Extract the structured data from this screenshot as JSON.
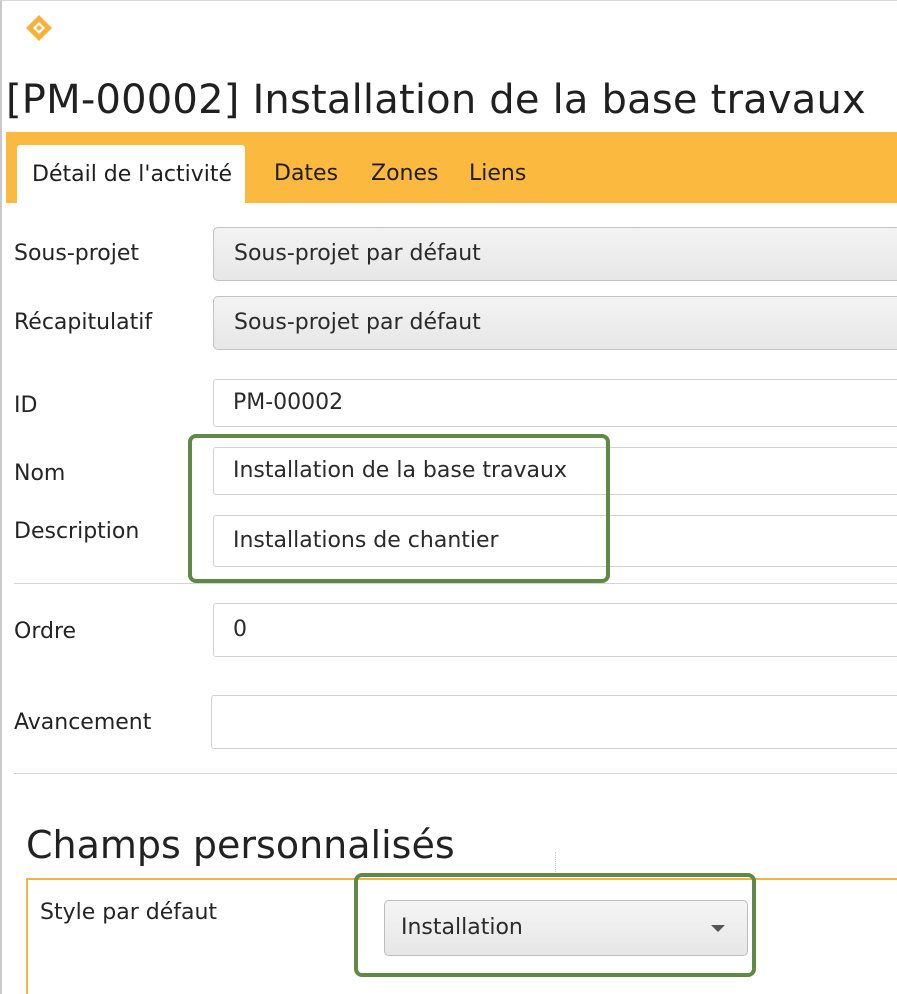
{
  "window": {
    "title": "[PM-00002] Installation de la base travaux",
    "logo_icon": "diamond-logo-icon"
  },
  "tabs": [
    {
      "label": "Détail de l'activité",
      "active": true
    },
    {
      "label": "Dates",
      "active": false
    },
    {
      "label": "Zones",
      "active": false
    },
    {
      "label": "Liens",
      "active": false
    }
  ],
  "form": {
    "sous_projet": {
      "label": "Sous-projet",
      "value": "Sous-projet par défaut"
    },
    "recapitulatif": {
      "label": "Récapitulatif",
      "value": "Sous-projet par défaut"
    },
    "id": {
      "label": "ID",
      "value": "PM-00002"
    },
    "nom": {
      "label": "Nom",
      "value": "Installation de la base travaux"
    },
    "description": {
      "label": "Description",
      "value": "Installations de chantier"
    },
    "ordre": {
      "label": "Ordre",
      "value": "0"
    },
    "avancement": {
      "label": "Avancement",
      "value": ""
    }
  },
  "custom_fields": {
    "title": "Champs personnalisés",
    "style": {
      "label": "Style par défaut",
      "value": "Installation"
    }
  },
  "colors": {
    "accent": "#fbb93f",
    "highlight": "#5f8a45"
  }
}
